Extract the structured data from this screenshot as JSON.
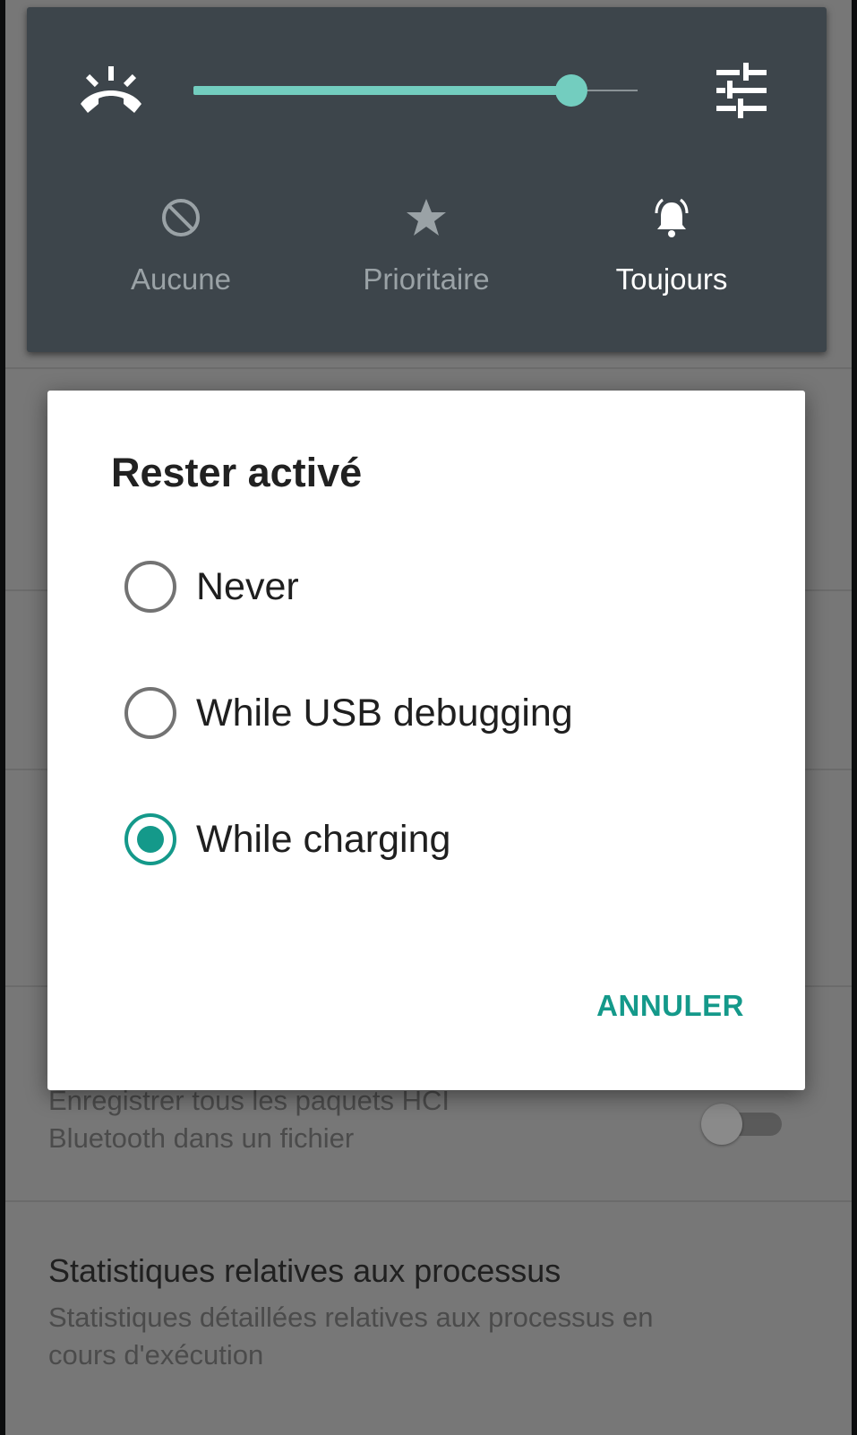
{
  "quick_settings": {
    "volume_level_percent": 85,
    "modes": [
      {
        "label": "Aucune",
        "icon": "block-icon",
        "active": false
      },
      {
        "label": "Prioritaire",
        "icon": "star-icon",
        "active": false
      },
      {
        "label": "Toujours",
        "icon": "bell-ringing-icon",
        "active": true
      }
    ],
    "accent_color": "#73cdbf"
  },
  "background_settings": {
    "hci_snoop": {
      "subtitle_line1": "Enregistrer tous les paquets HCI",
      "subtitle_line2": "Bluetooth dans un fichier",
      "toggle_on": false
    },
    "process_stats": {
      "title": "Statistiques relatives aux processus",
      "subtitle_line1": "Statistiques détaillées relatives aux processus en",
      "subtitle_line2": "cours d'exécution"
    }
  },
  "dialog": {
    "title": "Rester activé",
    "options": [
      {
        "label": "Never",
        "checked": false
      },
      {
        "label": "While USB debugging",
        "checked": false
      },
      {
        "label": "While charging",
        "checked": true
      }
    ],
    "cancel_label": "ANNULER",
    "accent_color": "#14998a"
  }
}
